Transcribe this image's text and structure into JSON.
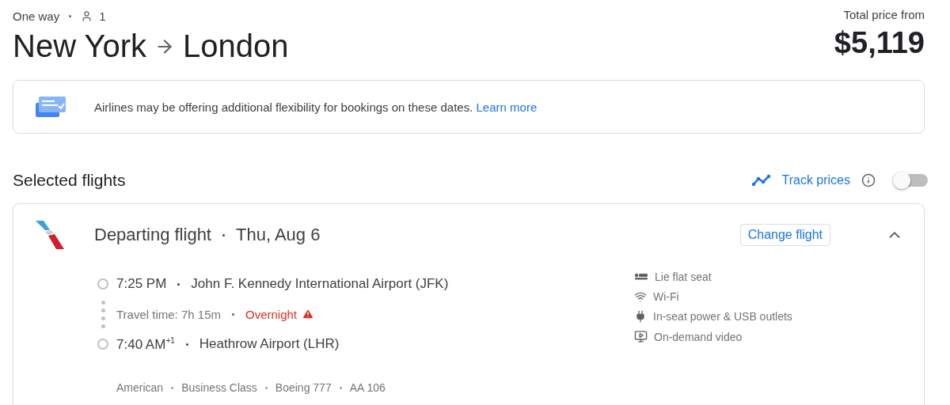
{
  "trip": {
    "type": "One way",
    "passengers": "1"
  },
  "route": {
    "origin": "New York",
    "destination": "London"
  },
  "price": {
    "label": "Total price from",
    "amount": "$5,119"
  },
  "notice": {
    "text": "Airlines may be offering additional flexibility for bookings on these dates.",
    "link": "Learn more"
  },
  "selected": {
    "title": "Selected flights",
    "track_label": "Track prices",
    "track_on": false
  },
  "flight": {
    "title": "Departing flight",
    "date": "Thu, Aug 6",
    "change": "Change flight",
    "expanded": true,
    "departure": {
      "time": "7:25 PM",
      "airport": "John F. Kennedy International Airport (JFK)"
    },
    "travel_time": "Travel time: 7h 15m",
    "overnight": "Overnight",
    "arrival": {
      "time": "7:40 AM",
      "day_offset": "+1",
      "airport": "Heathrow Airport (LHR)"
    },
    "details": [
      "American",
      "Business Class",
      "Boeing 777",
      "AA 106"
    ],
    "amenities": [
      {
        "kind": "seat",
        "label": "Lie flat seat"
      },
      {
        "kind": "wifi",
        "label": "Wi-Fi"
      },
      {
        "kind": "power",
        "label": "In-seat power & USB outlets"
      },
      {
        "kind": "video",
        "label": "On-demand video"
      }
    ]
  }
}
